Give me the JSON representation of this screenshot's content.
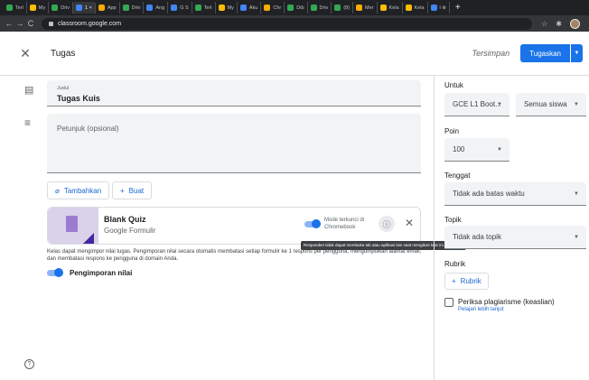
{
  "browser": {
    "tabs": [
      {
        "label": "Terl",
        "color": "#34a853"
      },
      {
        "label": "My",
        "color": "#fbbc04"
      },
      {
        "label": "Driv",
        "color": "#34a853"
      },
      {
        "label": "1 ×",
        "color": "#4285f4",
        "active": true
      },
      {
        "label": "App",
        "color": "#f9ab00"
      },
      {
        "label": "Driv",
        "color": "#34a853"
      },
      {
        "label": "Ang",
        "color": "#4285f4"
      },
      {
        "label": "G S",
        "color": "#4285f4"
      },
      {
        "label": "Terl",
        "color": "#34a853"
      },
      {
        "label": "My",
        "color": "#fbbc04"
      },
      {
        "label": "Aku",
        "color": "#4285f4"
      },
      {
        "label": "Chr",
        "color": "#f9ab00"
      },
      {
        "label": "Dib",
        "color": "#34a853"
      },
      {
        "label": "Driv",
        "color": "#34a853"
      },
      {
        "label": "(8)",
        "color": "#34a853"
      },
      {
        "label": "Mer",
        "color": "#f9ab00"
      },
      {
        "label": "Kela",
        "color": "#fbbc04"
      },
      {
        "label": "Kela",
        "color": "#fbbc04"
      },
      {
        "label": "l ⊗",
        "color": "#4285f4"
      }
    ],
    "url": "classroom.google.com"
  },
  "header": {
    "title": "Tugas",
    "saved": "Tersimpan",
    "assign": "Tugaskan"
  },
  "form": {
    "title_label": "Judul",
    "title_value": "Tugas Kuis",
    "instructions_placeholder": "Petunjuk (opsional)",
    "add_button": "Tambahkan",
    "create_button": "Buat"
  },
  "attachment": {
    "title": "Blank Quiz",
    "subtitle": "Google Formulir",
    "lock_mode": [
      "Mode terkunci di",
      "Chromebook"
    ],
    "tooltip": "Responden tidak dapat membuka tab atau aplikasi lain saat mengikuti kuis ini."
  },
  "grading_note": "Kelas dapat mengimpor nilai tugas. Pengimporan nilai secara otomatis membatasi setiap formulir ke 1 respons per pengguna, mengumpulkan alamat email, dan membatasi respons ke pengguna di domain Anda.",
  "grade_import": "Pengimporan nilai",
  "sidebar": {
    "for_label": "Untuk",
    "class_value": "GCE L1 Boot...",
    "students_value": "Semua siswa",
    "points_label": "Poin",
    "points_value": "100",
    "due_label": "Tenggat",
    "due_value": "Tidak ada batas waktu",
    "topic_label": "Topik",
    "topic_value": "Tidak ada topik",
    "rubric_label": "Rubrik",
    "rubric_button": "Rubrik",
    "plagiarism": "Periksa plagiarisme (keaslian)",
    "learn_more": "Pelajari lebih lanjut"
  }
}
